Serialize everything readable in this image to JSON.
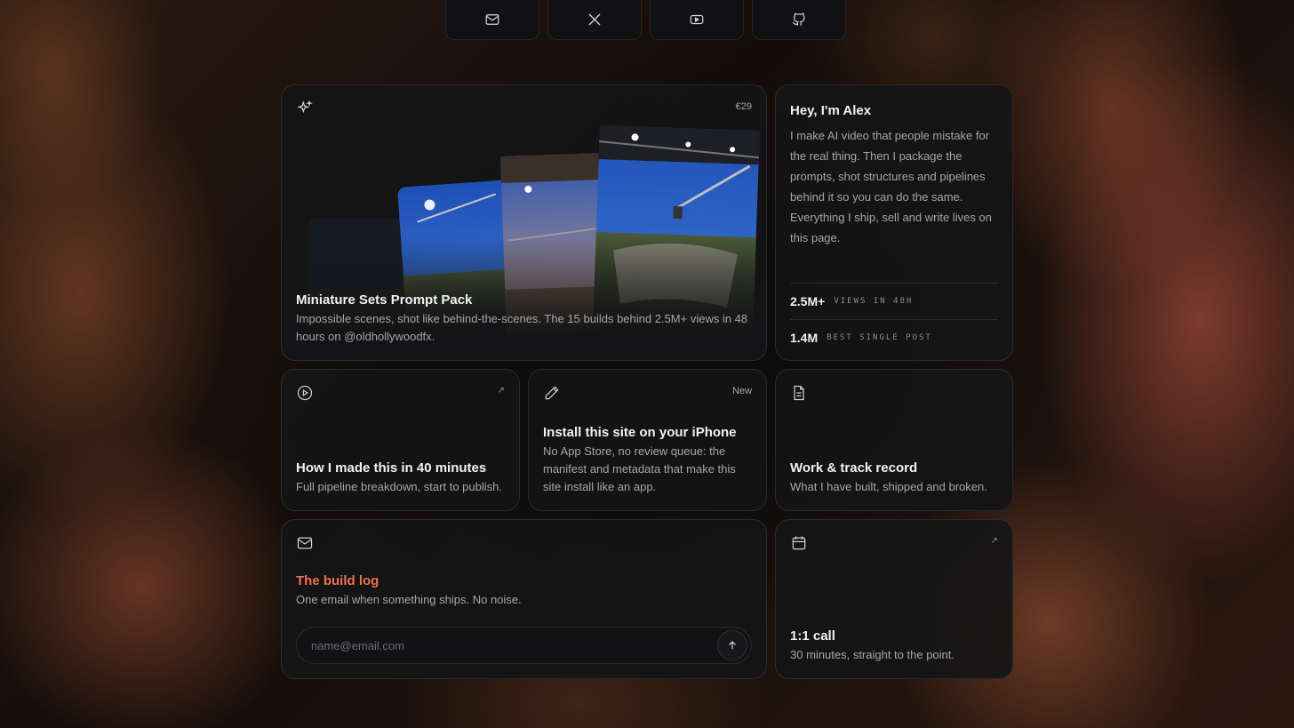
{
  "social": [
    {
      "icon": "mail-icon"
    },
    {
      "icon": "x-icon"
    },
    {
      "icon": "youtube-icon"
    },
    {
      "icon": "github-icon"
    }
  ],
  "hero": {
    "icon": "sparkles-icon",
    "price": "€29",
    "title": "Miniature Sets Prompt Pack",
    "description": "Impossible scenes, shot like behind-the-scenes. The 15 builds behind 2.5M+ views in 48 hours on @oldhollywoodfx."
  },
  "about": {
    "title": "Hey, I'm Alex",
    "description": "I make AI video that people mistake for the real thing. Then I package the prompts, shot structures and pipelines behind it so you can do the same. Everything I ship, sell and write lives on this page.",
    "stats": [
      {
        "value": "2.5M+",
        "label": "VIEWS IN 48H"
      },
      {
        "value": "1.4M",
        "label": "BEST SINGLE POST"
      }
    ]
  },
  "video": {
    "icon": "play-circle-icon",
    "arrow": "↗",
    "title": "How I made this in 40 minutes",
    "description": "Full pipeline breakdown, start to publish."
  },
  "install": {
    "icon": "pencil-icon",
    "tag": "New",
    "title": "Install this site on your iPhone",
    "description": "No App Store, no review queue: the manifest and metadata that make this site install like an app."
  },
  "work": {
    "icon": "document-icon",
    "title": "Work & track record",
    "description": "What I have built, shipped and broken."
  },
  "buildlog": {
    "icon": "mail-icon",
    "title": "The build log",
    "description": "One email when something ships. No noise.",
    "email_placeholder": "name@email.com",
    "email_value": ""
  },
  "call": {
    "icon": "calendar-icon",
    "arrow": "↗",
    "title": "1:1 call",
    "description": "30 minutes, straight to the point."
  },
  "colors": {
    "accent": "#f0704f",
    "card_bg": "#141416",
    "border": "#2a2a2e"
  }
}
